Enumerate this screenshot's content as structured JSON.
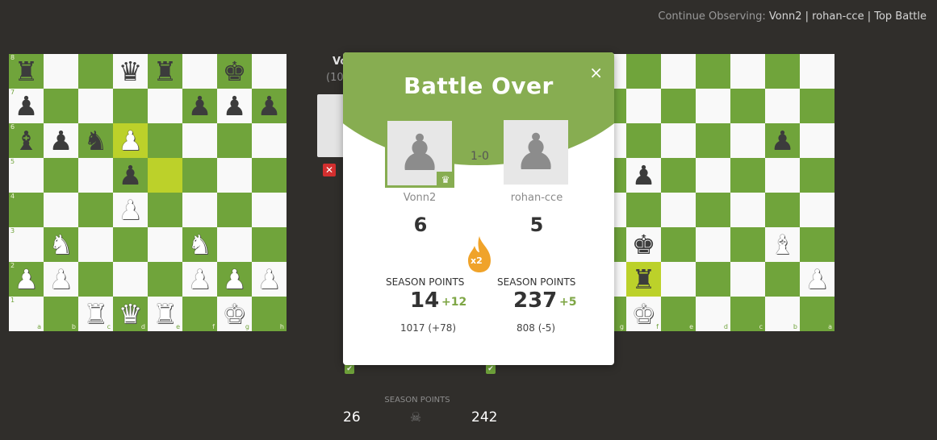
{
  "header": {
    "continue_prefix": "Continue Observing: ",
    "player1": "Vonn2",
    "player2": "rohan-cce",
    "event": "Top Battle",
    "separator": " | "
  },
  "behind": {
    "name": "Vo",
    "rating": "(10",
    "icon": "close-icon"
  },
  "left_board": {
    "ranks": [
      "8",
      "7",
      "6",
      "5",
      "4",
      "3",
      "2",
      "1"
    ],
    "files": [
      "a",
      "b",
      "c",
      "d",
      "e",
      "f",
      "g",
      "h"
    ],
    "highlight": [
      "d6",
      "e5"
    ],
    "pieces": {
      "a8": "bR",
      "d8": "bQ",
      "e8": "bR",
      "g8": "bK",
      "a7": "bP",
      "f7": "bP",
      "g7": "bP",
      "h7": "bP",
      "a6": "bB",
      "b6": "bP",
      "c6": "bN",
      "d6": "wP",
      "d5": "bP",
      "d4": "wP",
      "b3": "wN",
      "f3": "wN",
      "a2": "wP",
      "b2": "wP",
      "f2": "wP",
      "g2": "wP",
      "h2": "wP",
      "c1": "wR",
      "d1": "wQ",
      "e1": "wR",
      "g1": "wK"
    }
  },
  "right_board": {
    "files": [
      "h",
      "g",
      "f",
      "e",
      "d",
      "c",
      "b",
      "a"
    ],
    "highlight": [
      "f7"
    ],
    "pieces": {
      "f8": "wK",
      "f7": "bR",
      "a7": "wP",
      "f6": "bK",
      "b6": "wB",
      "f4": "bP",
      "b3": "bP"
    }
  },
  "modal": {
    "title": "Battle Over",
    "close": "×",
    "result": "1-0",
    "player1": {
      "name": "Vonn2",
      "score": "6",
      "season_label": "SEASON POINTS",
      "season_points": "14",
      "delta": "+12",
      "rating": "1017 (+78)",
      "badge_icon": "crown-icon"
    },
    "player2": {
      "name": "rohan-cce",
      "score": "5",
      "season_label": "SEASON POINTS",
      "season_points": "237",
      "delta": "+5",
      "rating": "808 (-5)"
    },
    "multiplier": "x2",
    "multiplier_icon": "flame-icon"
  },
  "footer": {
    "label": "SEASON POINTS",
    "left_value": "26",
    "right_value": "242",
    "icon": "skull-icon"
  },
  "colors": {
    "dark_square": "#70a43b",
    "light_square": "#f9f9f9",
    "highlight": "#bcd12a",
    "accent": "#87ad51",
    "flame": "#f0a32a"
  }
}
